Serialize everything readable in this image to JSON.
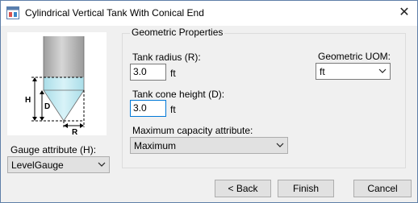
{
  "window": {
    "title": "Cylindrical Vertical Tank With Conical End",
    "close_glyph": "✕"
  },
  "diagram": {
    "label_h": "H",
    "label_d": "D",
    "label_r": "R",
    "liquid_color": "#c5ecf3",
    "tank_color": "#b8b8b8"
  },
  "gauge": {
    "label": "Gauge attribute (H):",
    "value": "LevelGauge"
  },
  "geometric": {
    "group_title": "Geometric Properties",
    "radius_label": "Tank radius (R):",
    "radius_value": "3.0",
    "radius_unit": "ft",
    "cone_label": "Tank cone height (D):",
    "cone_value": "3.0",
    "cone_unit": "ft",
    "capacity_label": "Maximum capacity attribute:",
    "capacity_value": "Maximum",
    "uom_label": "Geometric UOM:",
    "uom_value": "ft"
  },
  "buttons": {
    "back": "< Back",
    "finish": "Finish",
    "cancel": "Cancel"
  }
}
